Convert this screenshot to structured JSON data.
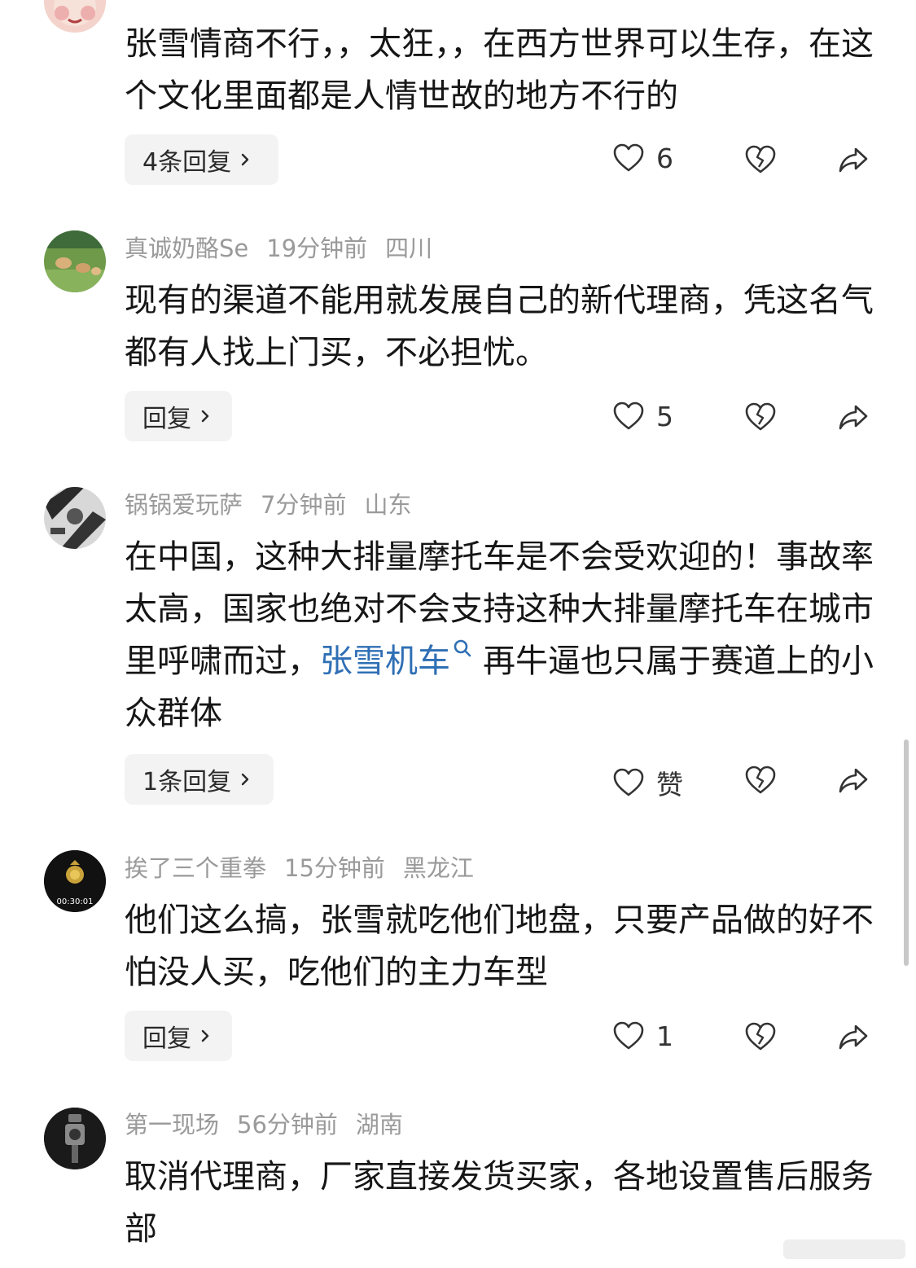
{
  "comments": [
    {
      "body": "张雪情商不行，，太狂，，在西方世界可以生存，在这个文化里面都是人情世故的地方不行的",
      "reply_label": "4条回复",
      "likes": "6"
    },
    {
      "username": "真诚奶酪Se",
      "time": "19分钟前",
      "location": "四川",
      "body": "现有的渠道不能用就发展自己的新代理商，凭这名气都有人找上门买，不必担忧。",
      "reply_label": "回复",
      "likes": "5"
    },
    {
      "username": "锅锅爱玩萨",
      "time": "7分钟前",
      "location": "山东",
      "body_before": "在中国，这种大排量摩托车是不会受欢迎的！事故率太高，国家也绝对不会支持这种大排量摩托车在城市里呼啸而过，",
      "keyword": "张雪机车",
      "body_after": "再牛逼也只属于赛道上的小众群体",
      "reply_label": "1条回复",
      "likes": "赞"
    },
    {
      "username": "挨了三个重拳",
      "time": "15分钟前",
      "location": "黑龙江",
      "avatar_text": "00:30:01",
      "body": "他们这么搞，张雪就吃他们地盘，只要产品做的好不怕没人买，吃他们的主力车型",
      "reply_label": "回复",
      "likes": "1"
    },
    {
      "username": "第一现场",
      "time": "56分钟前",
      "location": "湖南",
      "body": "取消代理商，厂家直接发货买家，各地设置售后服务部"
    }
  ],
  "icons": {
    "like": "heart-outline-icon",
    "dislike": "broken-heart-icon",
    "share": "share-arrow-icon",
    "search": "search-icon",
    "chevron": "chevron-right-icon"
  },
  "colors": {
    "keyword": "#2f6fb5",
    "meta": "#9a9a9a",
    "reply_bg": "#f3f3f3"
  }
}
